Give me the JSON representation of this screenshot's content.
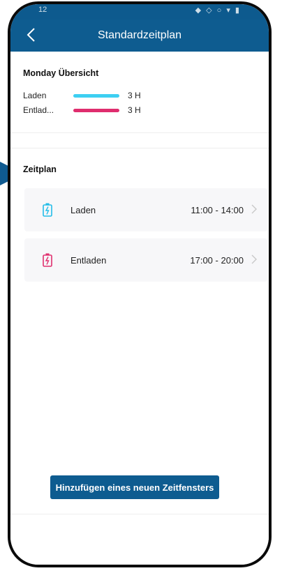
{
  "status_bar": {
    "time": "12",
    "icons": "◆ ◇ ○ ▾ ▮"
  },
  "header": {
    "title": "Standardzeitplan"
  },
  "overview": {
    "title": "Monday Übersicht",
    "rows": [
      {
        "label": "Laden",
        "value": "3 H",
        "color": "#3dcff2"
      },
      {
        "label": "Entlad...",
        "value": "3 H",
        "color": "#df2d6e"
      }
    ]
  },
  "schedule": {
    "title": "Zeitplan",
    "items": [
      {
        "label": "Laden",
        "time": "11:00 - 14:00",
        "icon": "battery-charge-icon",
        "color": "#23bde8"
      },
      {
        "label": "Entladen",
        "time": "17:00 - 20:00",
        "icon": "battery-discharge-icon",
        "color": "#e0306f"
      }
    ]
  },
  "footer": {
    "add_button_label": "Hinzufügen eines neuen Zeitfensters"
  },
  "colors": {
    "primary": "#0e5c90"
  }
}
